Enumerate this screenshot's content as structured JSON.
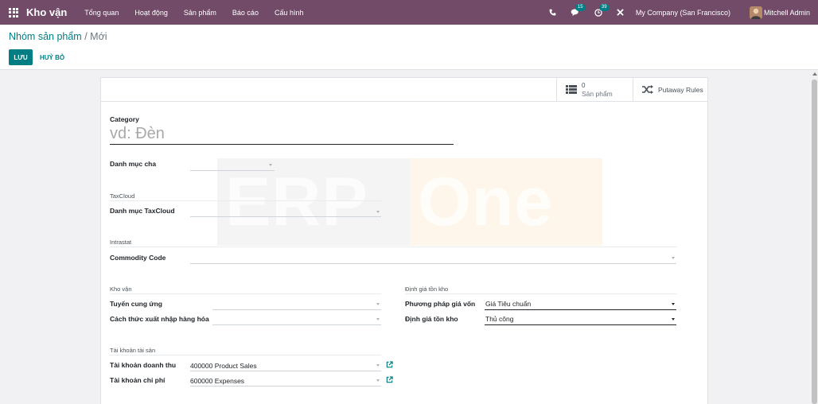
{
  "navbar": {
    "brand": "Kho vận",
    "menu": [
      "Tổng quan",
      "Hoạt động",
      "Sản phẩm",
      "Báo cáo",
      "Cấu hình"
    ],
    "messages_badge": "15",
    "activities_badge": "39",
    "company": "My Company (San Francisco)",
    "user": "Mitchell Admin",
    "icons": [
      "apps-icon",
      "phone-icon",
      "chat-icon",
      "clock-icon",
      "close-icon"
    ],
    "color": "#714b67"
  },
  "breadcrumb": {
    "parent": "Nhóm sản phẩm",
    "separator": "/",
    "current": "Mới"
  },
  "buttons": {
    "save": "LƯU",
    "discard": "HUỶ BỎ",
    "accent": "#017e84"
  },
  "smart_buttons": {
    "products_count": "0",
    "products_label": "Sản phẩm",
    "putaway": "Putaway Rules"
  },
  "form": {
    "category_label": "Category",
    "category_placeholder": "vd: Đèn",
    "parent_label": "Danh mục cha",
    "taxcloud_title": "TaxCloud",
    "taxcloud_label": "Danh mục TaxCloud",
    "intrastat_title": "Intrastat",
    "commodity_label": "Commodity Code",
    "logistics_title": "Kho vận",
    "routes_label": "Tuyến cung ứng",
    "removal_label": "Cách thức xuất nhập hàng hóa",
    "valuation_title": "Định giá tồn kho",
    "costing_label": "Phương pháp giá vốn",
    "costing_value": "Giá Tiêu chuẩn",
    "valuation_label": "Định giá tồn kho",
    "valuation_value": "Thủ công",
    "accounts_title": "Tài khoản tài sản",
    "income_label": "Tài khoản doanh thu",
    "income_value": "400000 Product Sales",
    "expense_label": "Tài khoản chi phí",
    "expense_value": "600000 Expenses"
  },
  "watermark": {
    "left": "ERP",
    "right": "One"
  }
}
